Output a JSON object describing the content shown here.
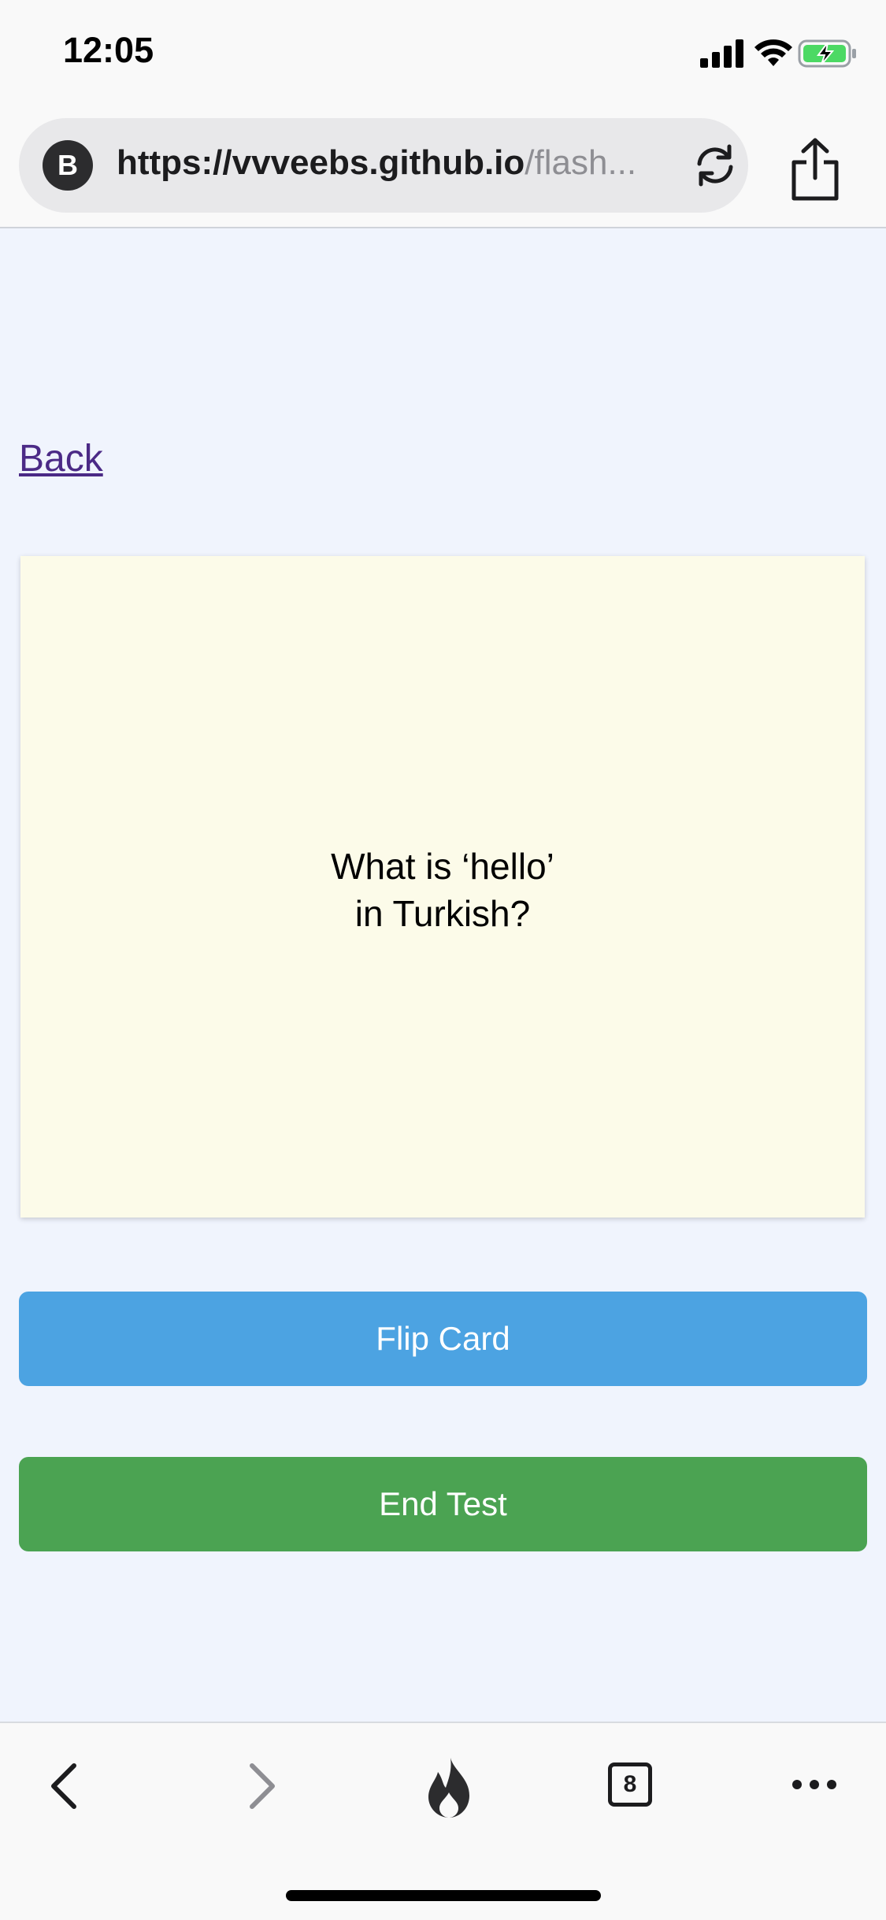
{
  "status_bar": {
    "time": "12:05",
    "icons": [
      "signal-icon",
      "wifi-icon",
      "battery-charging-icon"
    ]
  },
  "browser": {
    "site_badge": "B",
    "url_domain": "https://vvveebs.github.io",
    "url_path": "/flash...",
    "reload_icon": "reload-icon",
    "share_icon": "share-icon"
  },
  "page": {
    "back_link": "Back",
    "card_question_line1": "What is ‘hello’",
    "card_question_line2": "in Turkish?",
    "flip_button": "Flip Card",
    "end_button": "End Test"
  },
  "toolbar": {
    "tab_count": "8",
    "icons": [
      "back-arrow-icon",
      "forward-arrow-icon",
      "flame-icon",
      "tabs-icon",
      "more-icon"
    ]
  },
  "colors": {
    "page_background": "#f0f4fd",
    "card_background": "#fcfbe9",
    "flip_button": "#4ca3e2",
    "end_button": "#4ba352",
    "link": "#4b2a86"
  }
}
